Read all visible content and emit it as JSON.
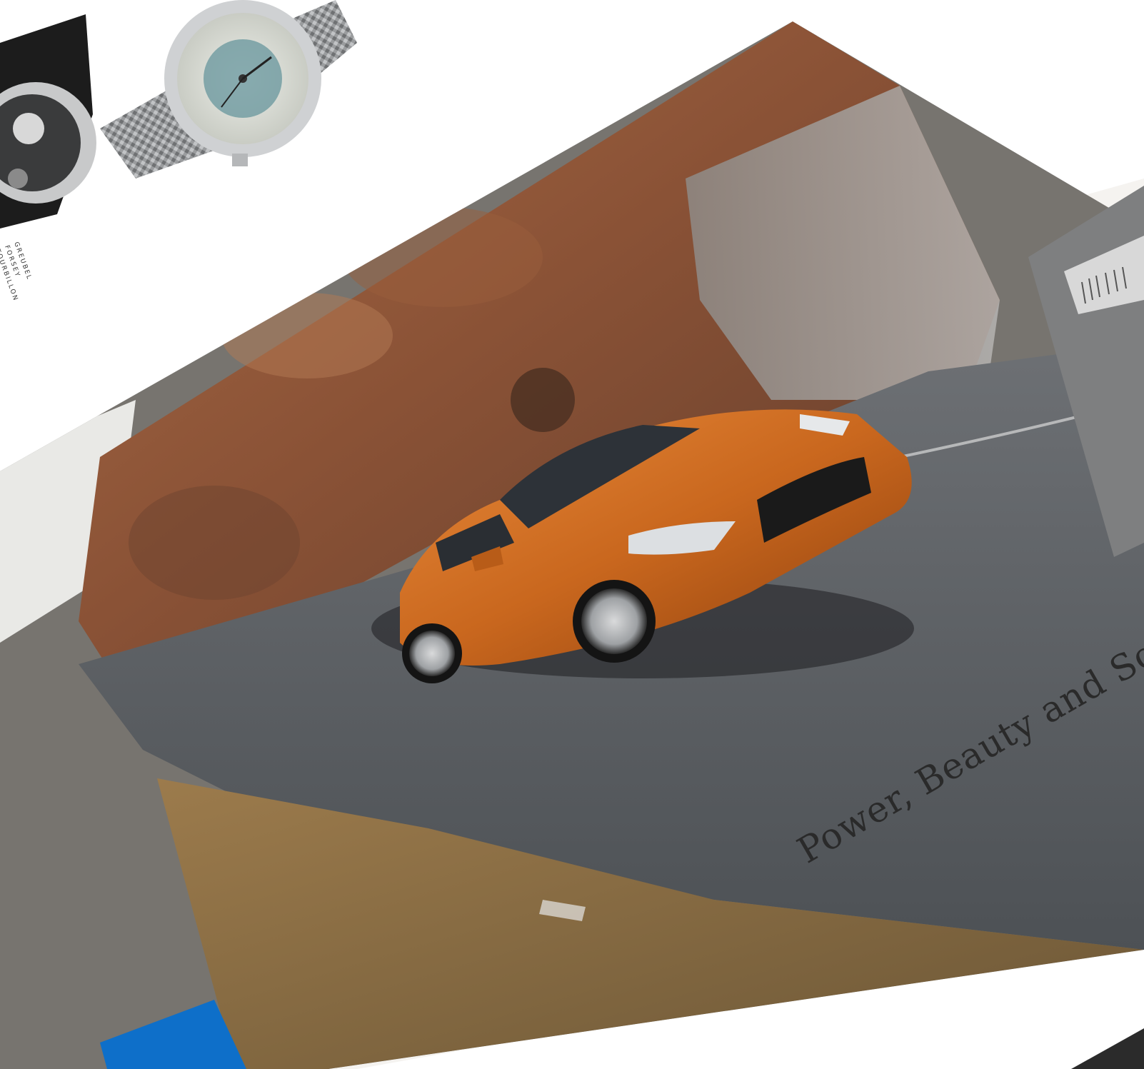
{
  "scene": {
    "description_free": true,
    "headline": "Power, Beauty and So",
    "watch_caption_lines": [
      "GREUBEL",
      "FORSEY",
      "TOURBILLON"
    ],
    "colors": {
      "car_paint": "#c9671e",
      "rock": "#8a5236",
      "road": "#5b5f63",
      "page": "#ffffff",
      "accent_blue": "#0e6fc9"
    }
  }
}
